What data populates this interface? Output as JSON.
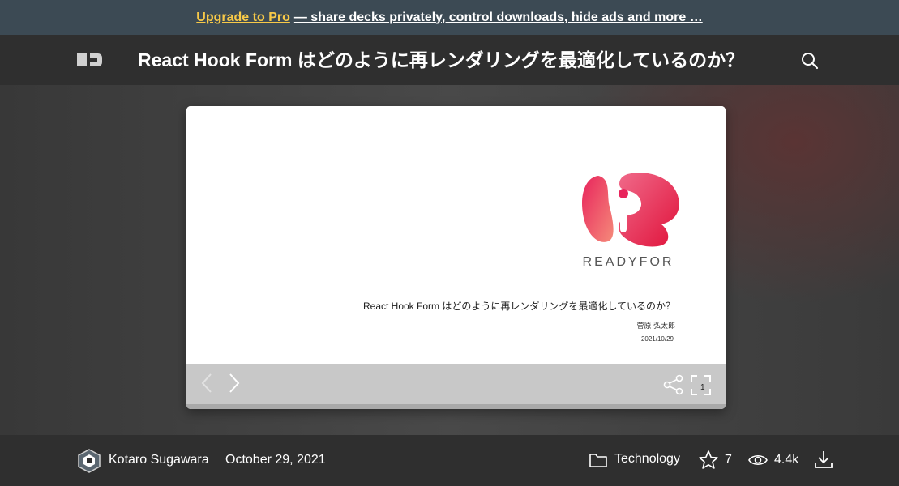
{
  "promo": {
    "link": "Upgrade to Pro",
    "text": "— share decks privately, control downloads, hide ads and more …"
  },
  "header": {
    "logo": "SD",
    "title": "React Hook Form はどのように再レンダリングを最適化しているのか？",
    "search_icon": "search-icon"
  },
  "slide": {
    "brand": "READYFOR",
    "title": "React Hook Form はどのように再レンダリングを最適化しているのか？",
    "author": "菅原 弘太郎",
    "date": "2021/10/29"
  },
  "controls": {
    "page": "1",
    "icons": [
      "chevron-left-icon",
      "chevron-right-icon",
      "share-icon",
      "fullscreen-icon"
    ]
  },
  "footer": {
    "author": "Kotaro Sugawara",
    "date": "October 29, 2021",
    "category": "Technology",
    "stars": "7",
    "views": "4.4k",
    "icons": [
      "folder-icon",
      "star-icon",
      "eye-icon",
      "download-icon"
    ]
  },
  "colors": {
    "promo_bg": "#3c4a54",
    "pro_accent": "#f7c948",
    "header_bg": "#2f2f2f",
    "brand_pink": "#e8245c"
  }
}
